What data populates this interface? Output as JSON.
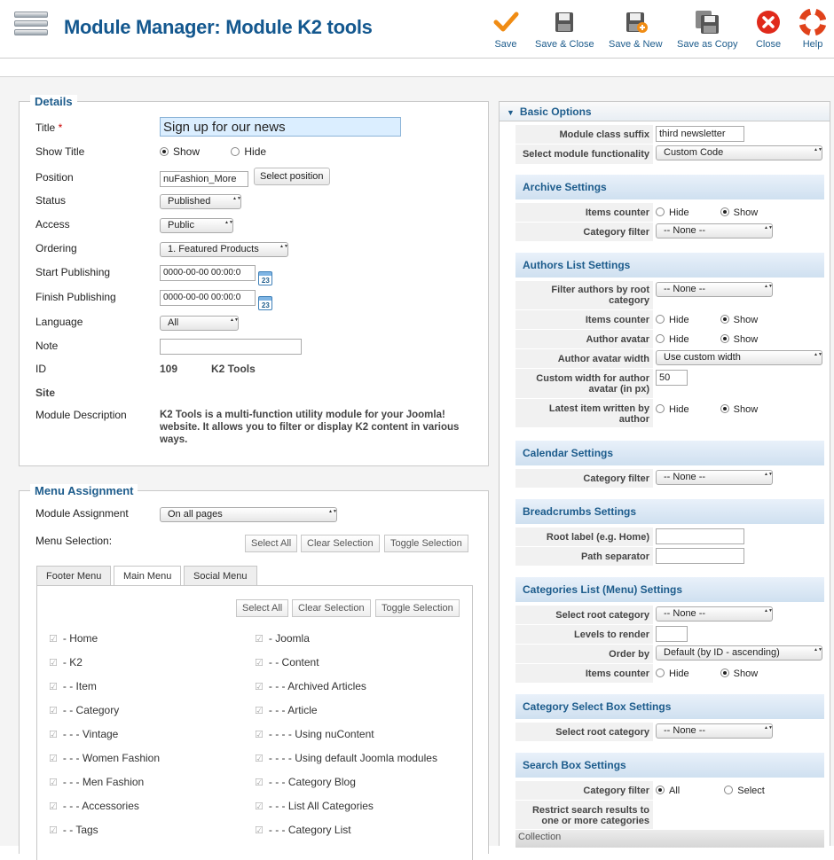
{
  "header": {
    "title": "Module Manager: Module K2 tools"
  },
  "toolbar": {
    "save": "Save",
    "save_close": "Save & Close",
    "save_new": "Save & New",
    "save_copy": "Save as Copy",
    "close": "Close",
    "help": "Help"
  },
  "details": {
    "legend": "Details",
    "title_label": "Title",
    "title_star": "*",
    "title_value": "Sign up for our news",
    "show_title_label": "Show Title",
    "show": "Show",
    "hide": "Hide",
    "position_label": "Position",
    "position_value": "nuFashion_More",
    "select_position": "Select position",
    "status_label": "Status",
    "status_value": "Published",
    "access_label": "Access",
    "access_value": "Public",
    "ordering_label": "Ordering",
    "ordering_value": "1. Featured Products",
    "start_label": "Start Publishing",
    "start_value": "0000-00-00 00:00:0",
    "finish_label": "Finish Publishing",
    "finish_value": "0000-00-00 00:00:0",
    "cal_day": "23",
    "language_label": "Language",
    "language_value": "All",
    "note_label": "Note",
    "id_label": "ID",
    "id_value": "109",
    "id_type": "K2 Tools",
    "site_label": "Site",
    "desc_label": "Module Description",
    "desc_value": "K2 Tools is a multi-function utility module for your Joomla! website. It allows you to filter or display K2 content in various ways."
  },
  "menu_assignment": {
    "legend": "Menu Assignment",
    "module_assignment_label": "Module Assignment",
    "module_assignment_value": "On all pages",
    "menu_selection_label": "Menu Selection:",
    "select_all": "Select All",
    "clear_selection": "Clear Selection",
    "toggle_selection": "Toggle Selection",
    "tabs": [
      {
        "label": "Footer Menu"
      },
      {
        "label": "Main Menu"
      },
      {
        "label": "Social Menu"
      }
    ],
    "items_left": [
      "- Home",
      "- K2",
      "- - Item",
      "- - Category",
      "- - - Vintage",
      "- - - Women Fashion",
      "- - - Men Fashion",
      "- - - Accessories",
      "- - Tags"
    ],
    "items_right": [
      "- Joomla",
      "- - Content",
      "- - - Archived Articles",
      "- - - Article",
      "- - - - Using nuContent",
      "- - - - Using default Joomla modules",
      "- - - Category Blog",
      "- - - List All Categories",
      "- - - Category List"
    ]
  },
  "basic_options": {
    "title": "Basic Options",
    "suffix_label": "Module class suffix",
    "suffix_value": "third newsletter",
    "functionality_label": "Select module functionality",
    "functionality_value": "Custom Code",
    "archive": {
      "title": "Archive Settings",
      "items_counter": "Items counter",
      "category_filter": "Category filter",
      "none": "-- None --"
    },
    "authors": {
      "title": "Authors List Settings",
      "filter_authors": "Filter authors by root category",
      "items_counter": "Items counter",
      "author_avatar": "Author avatar",
      "avatar_width": "Author avatar width",
      "avatar_width_value": "Use custom width",
      "custom_width": "Custom width for author avatar (in px)",
      "custom_width_value": "50",
      "latest_item": "Latest item written by author"
    },
    "calendar": {
      "title": "Calendar Settings",
      "category_filter": "Category filter"
    },
    "breadcrumbs": {
      "title": "Breadcrumbs Settings",
      "root_label": "Root label (e.g. Home)",
      "path_separator": "Path separator"
    },
    "categories": {
      "title": "Categories List (Menu) Settings",
      "select_root": "Select root category",
      "levels": "Levels to render",
      "order_by": "Order by",
      "order_value": "Default (by ID - ascending)",
      "items_counter": "Items counter"
    },
    "select_box": {
      "title": "Category Select Box Settings",
      "select_root": "Select root category"
    },
    "search": {
      "title": "Search Box Settings",
      "category_filter": "Category filter",
      "all": "All",
      "select": "Select",
      "restrict": "Restrict search results to one or more categories",
      "collection": "Collection"
    },
    "hide": "Hide",
    "show": "Show"
  }
}
